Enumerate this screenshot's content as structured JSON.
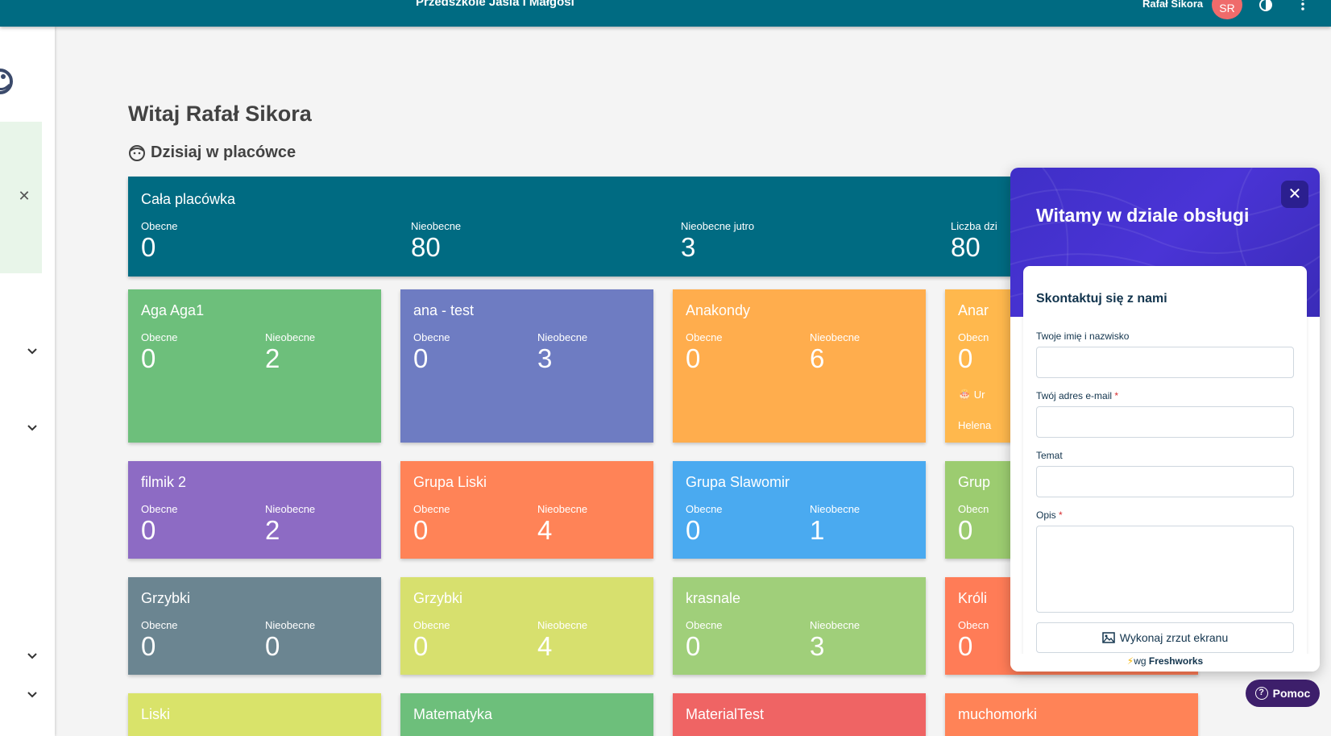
{
  "topbar": {
    "school_name": "Przedszkole Jasia i Małgosi",
    "user_name": "Rafał Sikora",
    "avatar_initials": "SR",
    "avatar_color": "#ef6b6b",
    "bar_color": "#006b82"
  },
  "main": {
    "greeting": "Witaj Rafał Sikora",
    "today_heading": "Dzisiaj w placówce"
  },
  "facility": {
    "title": "Cała placówka",
    "stats": [
      {
        "label": "Obecne",
        "value": "0"
      },
      {
        "label": "Nieobecne",
        "value": "80"
      },
      {
        "label": "Nieobecne jutro",
        "value": "3"
      },
      {
        "label": "Liczba dzi",
        "value": "80"
      }
    ]
  },
  "groups": [
    {
      "name": "Aga Aga1",
      "present_label": "Obecne",
      "present": "0",
      "absent_label": "Nieobecne",
      "absent": "2",
      "color": "#6dbf7b"
    },
    {
      "name": "ana - test",
      "present_label": "Obecne",
      "present": "0",
      "absent_label": "Nieobecne",
      "absent": "3",
      "color": "#6e7cc2"
    },
    {
      "name": "Anakondy",
      "present_label": "Obecne",
      "present": "0",
      "absent_label": "Nieobecne",
      "absent": "6",
      "color": "#ffad4d"
    },
    {
      "name": "Anar",
      "present_label": "Obecn",
      "present": "0",
      "absent_label": "",
      "absent": "",
      "color": "#ffb84d",
      "extra1": "🎂 Ur",
      "extra2": "Helena"
    },
    {
      "name": "filmik 2",
      "present_label": "Obecne",
      "present": "0",
      "absent_label": "Nieobecne",
      "absent": "2",
      "color": "#8d6bc4"
    },
    {
      "name": "Grupa Liski",
      "present_label": "Obecne",
      "present": "0",
      "absent_label": "Nieobecne",
      "absent": "4",
      "color": "#ff8357"
    },
    {
      "name": "Grupa Slawomir",
      "present_label": "Obecne",
      "present": "0",
      "absent_label": "Nieobecne",
      "absent": "1",
      "color": "#4aaaf0"
    },
    {
      "name": "Grup",
      "present_label": "Obecn",
      "present": "0",
      "absent_label": "",
      "absent": "",
      "color": "#9ccc70"
    },
    {
      "name": "Grzybki",
      "present_label": "Obecne",
      "present": "0",
      "absent_label": "Nieobecne",
      "absent": "0",
      "color": "#6b8591"
    },
    {
      "name": "Grzybki",
      "present_label": "Obecne",
      "present": "0",
      "absent_label": "Nieobecne",
      "absent": "4",
      "color": "#d7e06e"
    },
    {
      "name": "krasnale",
      "present_label": "Obecne",
      "present": "0",
      "absent_label": "Nieobecne",
      "absent": "3",
      "color": "#a0cf7a"
    },
    {
      "name": "Króli",
      "present_label": "Obecn",
      "present": "0",
      "absent_label": "",
      "absent": "",
      "color": "#ff7c57"
    },
    {
      "name": "Liski",
      "present_label": "",
      "present": "",
      "absent_label": "",
      "absent": "",
      "color": "#d9e36a"
    },
    {
      "name": "Matematyka",
      "present_label": "",
      "present": "",
      "absent_label": "",
      "absent": "",
      "color": "#6dbf7b"
    },
    {
      "name": "MaterialTest",
      "present_label": "",
      "present": "",
      "absent_label": "",
      "absent": "",
      "color": "#ef6464"
    },
    {
      "name": "muchomorki",
      "present_label": "",
      "present": "",
      "absent_label": "",
      "absent": "",
      "color": "#ff8357"
    }
  ],
  "widget": {
    "header_title": "Witamy w dziale obsługi",
    "close_symbol": "✕",
    "contact_title": "Skontaktuj się z nami",
    "name_label": "Twoje imię i nazwisko",
    "email_label": "Twój adres e-mail",
    "subject_label": "Temat",
    "description_label": "Opis",
    "required_mark": "*",
    "screenshot_label": "Wykonaj zrzut ekranu",
    "powered_prefix": "wg",
    "powered_brand": "Freshworks",
    "accent_color": "#4a34d6"
  },
  "help_button": {
    "label": "Pomoc",
    "icon_glyph": "?"
  },
  "icons": [
    "logo-icon",
    "close-icon",
    "chevron-down-icon",
    "contrast-icon",
    "more-vert-icon",
    "face-icon",
    "camera-icon",
    "bolt-icon",
    "help-icon"
  ]
}
